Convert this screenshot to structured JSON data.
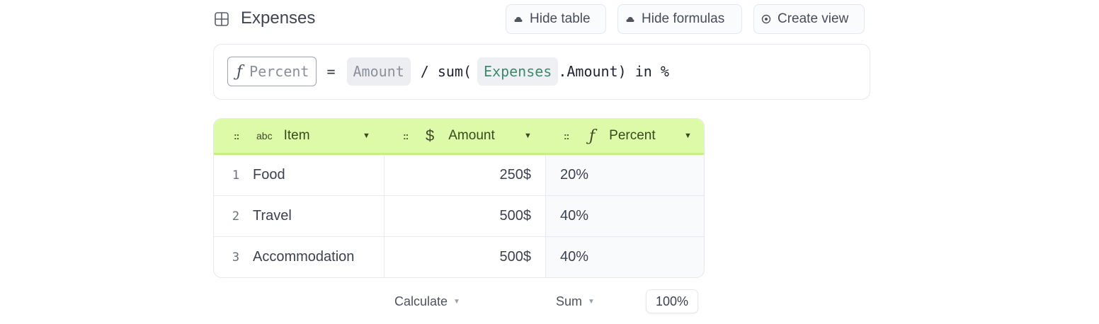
{
  "header": {
    "title": "Expenses",
    "title_icon": "table-grid-icon",
    "buttons": [
      {
        "label": "Hide table",
        "icon": "cloud-icon"
      },
      {
        "label": "Hide formulas",
        "icon": "cloud-icon"
      },
      {
        "label": "Create view",
        "icon": "eye-icon"
      }
    ]
  },
  "formula": {
    "column_symbol": "ƒ",
    "column_name": "Percent",
    "equals": "=",
    "operand": "Amount",
    "operator": "/ sum(",
    "table_ref": "Expenses",
    "tail": ".Amount) in %"
  },
  "table": {
    "header_color": "#dcfaa8",
    "columns": [
      {
        "grip": "::",
        "type_icon": "abc",
        "type_icon_name": "text-type-icon",
        "label": "Item"
      },
      {
        "grip": "::",
        "type_icon": "$",
        "type_icon_name": "dollar-icon",
        "label": "Amount"
      },
      {
        "grip": "::",
        "type_icon": "ƒ",
        "type_icon_name": "formula-icon",
        "label": "Percent"
      }
    ],
    "rows": [
      {
        "num": "1",
        "item": "Food",
        "amount": "250$",
        "percent": "20%"
      },
      {
        "num": "2",
        "item": "Travel",
        "amount": "500$",
        "percent": "40%"
      },
      {
        "num": "3",
        "item": "Accommodation",
        "amount": "500$",
        "percent": "40%"
      }
    ]
  },
  "footer": {
    "amount_calc": "Calculate",
    "percent_calc": "Sum",
    "percent_total": "100%"
  }
}
